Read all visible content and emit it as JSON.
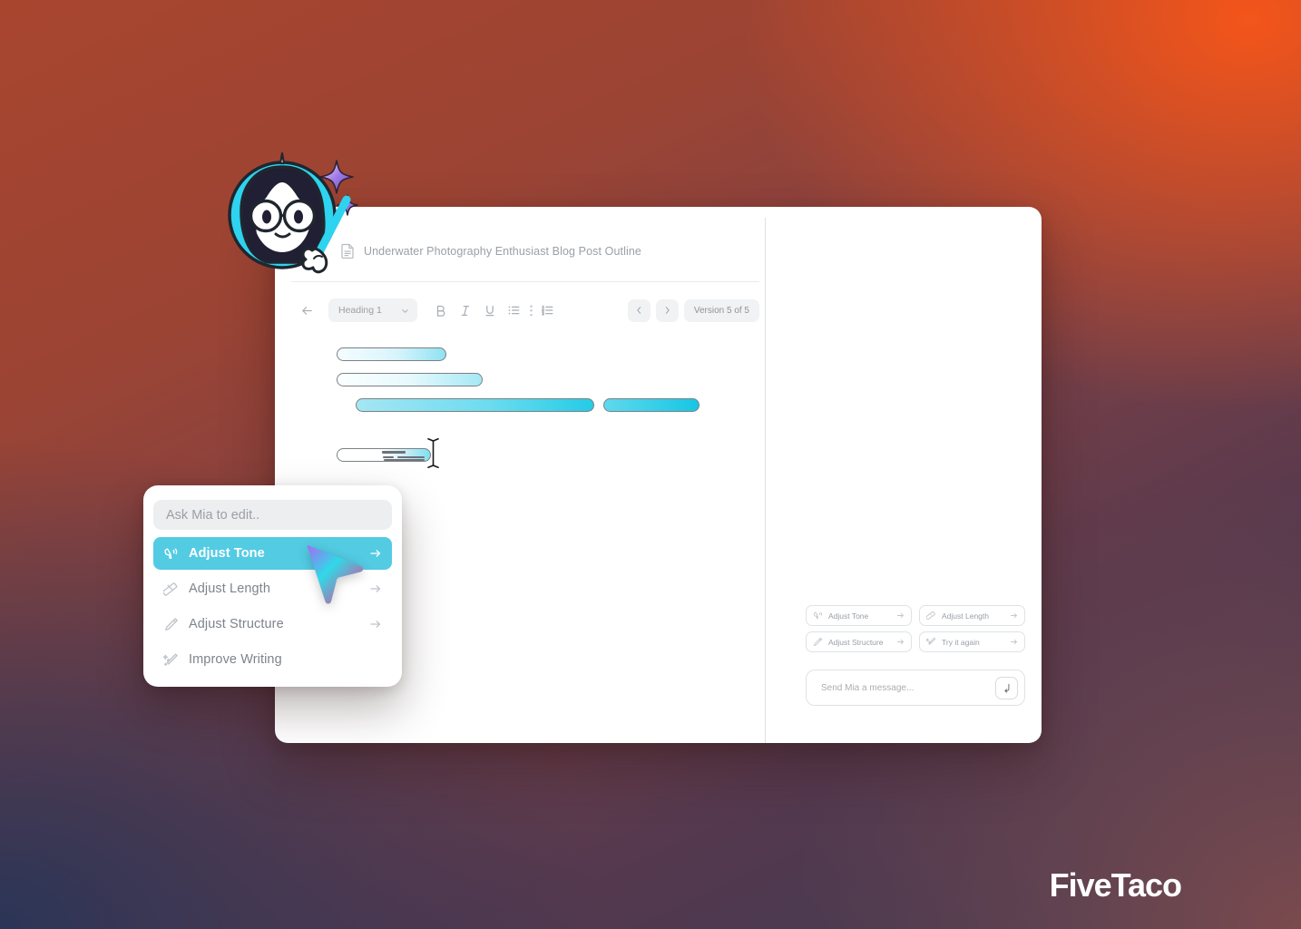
{
  "brand": {
    "logo_text": "FiveTaco",
    "accent_cyan": "#53cbe3",
    "bg_orange": "#f4551a",
    "bg_navy": "#2b3557"
  },
  "app": {
    "document": {
      "icon": "document-icon",
      "title": "Underwater Photography Enthusiast Blog Post Outline"
    },
    "toolbar": {
      "back_icon": "arrow-left-icon",
      "style_select": {
        "value": "Heading 1",
        "chevron": "chevron-down-icon"
      },
      "bold": "B",
      "italic": "I",
      "underline": "U",
      "bullet_list_icon": "bullet-list-icon",
      "more_icon": "more-vertical-icon",
      "numbered_list_icon": "numbered-list-icon",
      "prev_icon": "chevron-left-icon",
      "next_icon": "chevron-right-icon",
      "version_label": "Version 5 of 5"
    },
    "chat": {
      "chips": [
        {
          "label": "Adjust Tone",
          "icon": "megaphone-icon",
          "arrow": "arrow-right-icon"
        },
        {
          "label": "Adjust Length",
          "icon": "ruler-icon",
          "arrow": "arrow-right-icon"
        },
        {
          "label": "Adjust Structure",
          "icon": "pencil-icon",
          "arrow": "arrow-right-icon"
        },
        {
          "label": "Try it again",
          "icon": "magic-wand-icon",
          "arrow": "arrow-right-icon"
        }
      ],
      "composer": {
        "placeholder": "Send Mia a message...",
        "send_icon": "enter-arrow-icon"
      }
    }
  },
  "menu": {
    "search_placeholder": "Ask Mia to edit..",
    "items": [
      {
        "label": "Adjust Tone",
        "icon": "megaphone-icon",
        "arrow": "arrow-right-icon",
        "active": true
      },
      {
        "label": "Adjust Length",
        "icon": "ruler-icon",
        "arrow": "arrow-right-icon",
        "active": false
      },
      {
        "label": "Adjust Structure",
        "icon": "pencil-icon",
        "arrow": "arrow-right-icon",
        "active": false
      },
      {
        "label": "Improve Writing",
        "icon": "magic-wand-icon",
        "arrow": "",
        "active": false
      }
    ]
  },
  "mascot": {
    "name": "mia-mascot",
    "description": "Mia character with glasses holding a cyan pointer"
  }
}
